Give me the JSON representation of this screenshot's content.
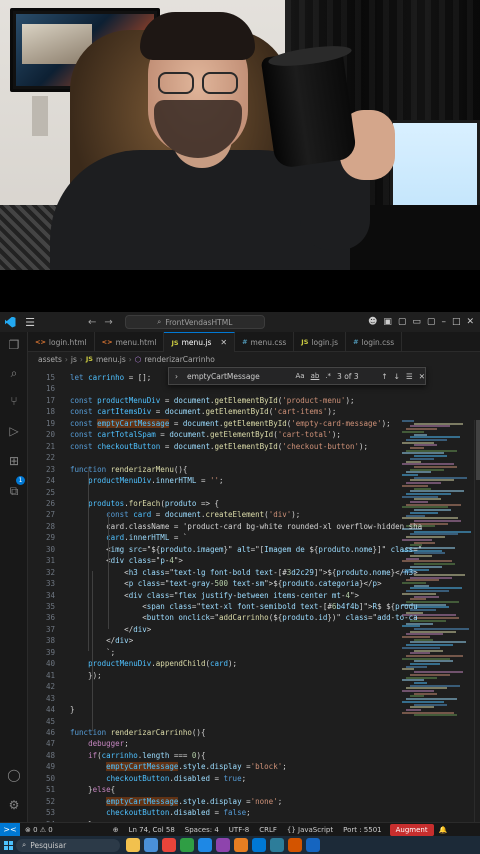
{
  "titlebar": {
    "search": "FrontVendasHTML",
    "nav_back": "←",
    "nav_forward": "→"
  },
  "tabs": [
    {
      "icon": "<>",
      "label": "login.html",
      "active": false
    },
    {
      "icon": "<>",
      "label": "menu.html",
      "active": false
    },
    {
      "icon": "JS",
      "label": "menu.js",
      "active": true
    },
    {
      "icon": "#",
      "label": "menu.css",
      "active": false
    },
    {
      "icon": "JS",
      "label": "login.js",
      "active": false
    },
    {
      "icon": "#",
      "label": "login.css",
      "active": false
    }
  ],
  "breadcrumb": [
    "assets",
    "js",
    "menu.js",
    "renderizarCarrinho"
  ],
  "find": {
    "query": "emptyCartMessage",
    "case_option": "Aa",
    "word_option": "ab",
    "regex_option": ".*",
    "count": "3 of 3"
  },
  "code_lines": [
    {
      "n": "15",
      "t": "let carrinho = [];"
    },
    {
      "n": "16",
      "t": ""
    },
    {
      "n": "17",
      "t": "const productMenuDiv = document.getElementById('product-menu');"
    },
    {
      "n": "18",
      "t": "const cartItemsDiv = document.getElementById('cart-items');"
    },
    {
      "n": "19",
      "t": "const emptyCartMessage = document.getElementById('empty-card-message');"
    },
    {
      "n": "20",
      "t": "const cartTotalSpam = document.getElementById('cart-total');"
    },
    {
      "n": "21",
      "t": "const checkoutButton = document.getElementById('checkout-button');"
    },
    {
      "n": "22",
      "t": ""
    },
    {
      "n": "23",
      "t": "function renderizarMenu(){"
    },
    {
      "n": "24",
      "t": "    productMenuDiv.innerHTML = '';"
    },
    {
      "n": "25",
      "t": ""
    },
    {
      "n": "26",
      "t": "    produtos.forEach(produto => {"
    },
    {
      "n": "27",
      "t": "        const card = document.createElement('div');"
    },
    {
      "n": "28",
      "t": "        card.className = 'product-card bg-white rounded-xl overflow-hidden sha"
    },
    {
      "n": "29",
      "t": "        card.innerHTML = `"
    },
    {
      "n": "30",
      "t": "        <img src=\"${produto.imagem}\" alt=\"[Imagem de ${produto.nome}]\" class=\""
    },
    {
      "n": "31",
      "t": "        <div class=\"p-4\">"
    },
    {
      "n": "32",
      "t": "            <h3 class=\"text-lg font-bold text-[#3d2c29]\">${produto.nome}</h3>"
    },
    {
      "n": "33",
      "t": "            <p class=\"text-gray-500 text-sm\">${produto.categoria}</p>"
    },
    {
      "n": "34",
      "t": "            <div class=\"flex justify-between items-center mt-4\">"
    },
    {
      "n": "35",
      "t": "                <span class=\"text-xl font-semibold text-[#6b4f4b]\">R$ ${produ"
    },
    {
      "n": "36",
      "t": "                <button onclick=\"addCarrinho(${produto.id})\" class=\"add-to-ca"
    },
    {
      "n": "37",
      "t": "            </div>"
    },
    {
      "n": "38",
      "t": "        </div>"
    },
    {
      "n": "39",
      "t": "        `;"
    },
    {
      "n": "40",
      "t": "    productMenuDiv.appendChild(card);"
    },
    {
      "n": "41",
      "t": "    });"
    },
    {
      "n": "42",
      "t": ""
    },
    {
      "n": "43",
      "t": ""
    },
    {
      "n": "44",
      "t": "}"
    },
    {
      "n": "45",
      "t": ""
    },
    {
      "n": "46",
      "t": "function renderizarCarrinho(){"
    },
    {
      "n": "47",
      "t": "    debugger;"
    },
    {
      "n": "48",
      "t": "    if(carrinho.length === 0){"
    },
    {
      "n": "49",
      "t": "        emptyCartMessage.style.display ='block';"
    },
    {
      "n": "50",
      "t": "        checkoutButton.disabled = true;"
    },
    {
      "n": "51",
      "t": "    }else{"
    },
    {
      "n": "52",
      "t": "        emptyCartMessage.style.display ='none';"
    },
    {
      "n": "53",
      "t": "        checkoutButton.disabled = false;"
    },
    {
      "n": "54",
      "t": "    }"
    }
  ],
  "statusbar": {
    "remote": "><",
    "problems": "⊗ 0 ⚠ 0",
    "position": "Ln 74, Col 58",
    "spaces": "Spaces: 4",
    "encoding": "UTF-8",
    "eol": "CRLF",
    "language": "{} JavaScript",
    "port": "Port : 5501",
    "augment": "Augment"
  },
  "taskbar": {
    "search_placeholder": "Pesquisar",
    "app_colors": [
      "#f2c14e",
      "#4a90d9",
      "#e8443a",
      "#2f9e44",
      "#1e88e5",
      "#8e44ad",
      "#e67e22",
      "#0078d4",
      "#2d7d9a",
      "#d35400",
      "#1565c0"
    ]
  },
  "colors": {
    "editor_bg": "#1e1e1e",
    "accent": "#0078d4",
    "find_highlight": "#613214",
    "augment": "#c72e2e"
  }
}
